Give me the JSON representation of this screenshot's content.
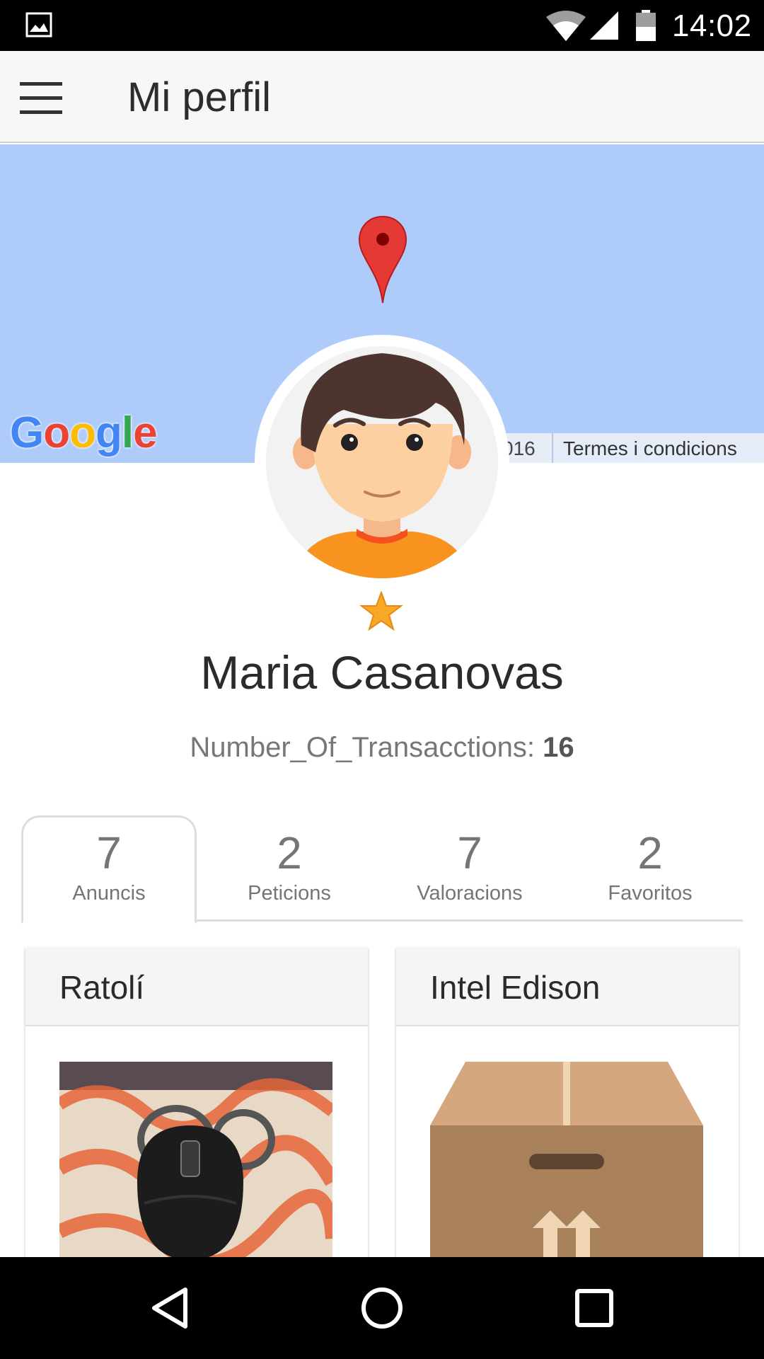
{
  "status_bar": {
    "time": "14:02",
    "icons": [
      "gallery-icon",
      "wifi-icon",
      "signal-icon",
      "battery-icon"
    ]
  },
  "app_bar": {
    "title": "Mi perfil",
    "menu_icon": "hamburger-menu-icon"
  },
  "map": {
    "logo_text": "Google",
    "copyright_fragment": "016",
    "terms_link": "Termes i condicions",
    "pin_icon": "map-pin-icon",
    "water_color": "#aecbfa"
  },
  "profile": {
    "avatar_icon": "user-avatar-icon",
    "rating_icon": "star-icon",
    "name": "Maria Casanovas",
    "transactions_label": "Number_Of_Transacctions:",
    "transactions_value": "16"
  },
  "tabs": [
    {
      "count": "7",
      "label": "Anuncis",
      "active": true
    },
    {
      "count": "2",
      "label": "Peticions",
      "active": false
    },
    {
      "count": "7",
      "label": "Valoracions",
      "active": false
    },
    {
      "count": "2",
      "label": "Favoritos",
      "active": false
    }
  ],
  "listings": [
    {
      "title": "Ratolí",
      "image": "mouse-photo"
    },
    {
      "title": "Intel Edison",
      "image": "cardboard-box-icon"
    }
  ],
  "nav_bar": {
    "buttons": [
      "back-icon",
      "home-icon",
      "recents-icon"
    ]
  },
  "colors": {
    "accent_star": "#f9a825",
    "pin_red": "#e53935",
    "map_blue": "#aecbfa"
  }
}
